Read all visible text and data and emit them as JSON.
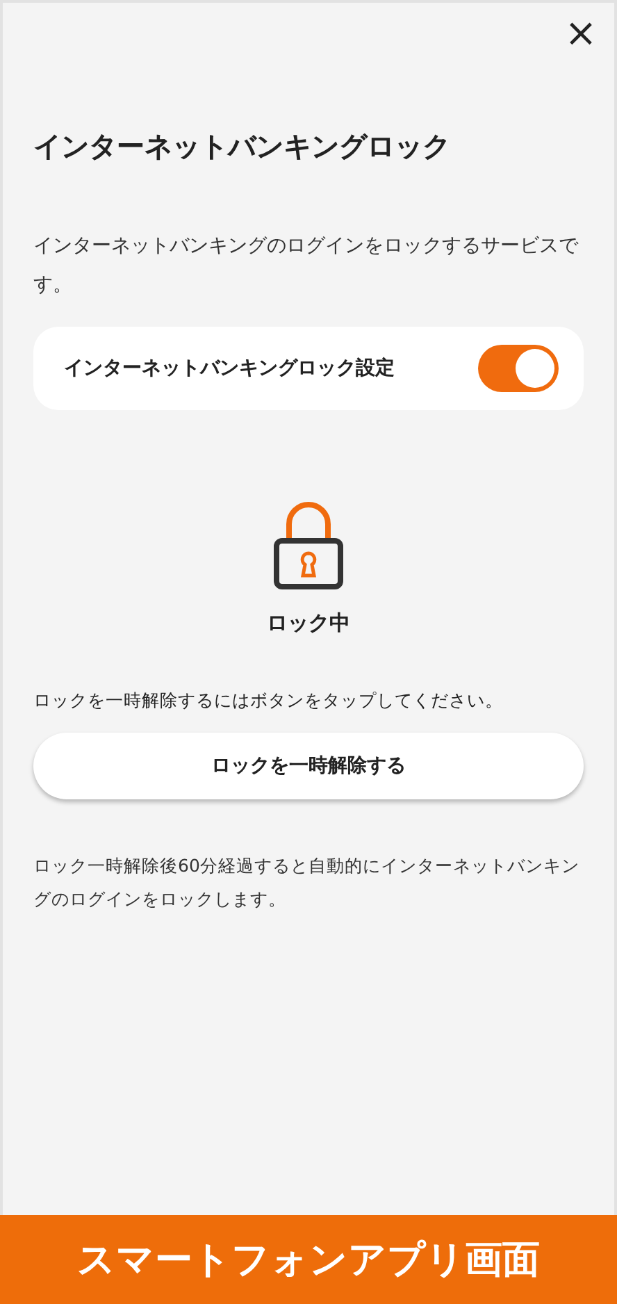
{
  "close_button": {
    "label": "×"
  },
  "title": "インターネットバンキングロック",
  "description": "インターネットバンキングのログインをロックするサービスです。",
  "setting": {
    "label": "インターネットバンキングロック設定",
    "on": true
  },
  "lock_status": {
    "locked": true,
    "label": "ロック中"
  },
  "hint": "ロックを一時解除するにはボタンをタップしてください。",
  "unlock_button": {
    "label": "ロックを一時解除する"
  },
  "note": "ロック一時解除後60分経過すると自動的にインターネットバンキングのログインをロックします。",
  "banner": "スマートフォンアプリ画面"
}
